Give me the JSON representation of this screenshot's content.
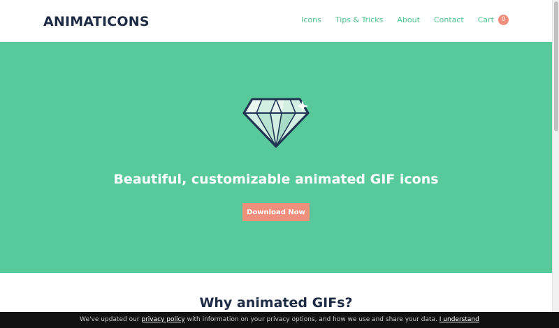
{
  "header": {
    "logo": "ANIMATICONS",
    "nav": [
      "Icons",
      "Tips & Tricks",
      "About",
      "Contact"
    ],
    "cart_label": "Cart",
    "cart_count": "0"
  },
  "hero": {
    "title": "Beautiful, customizable animated GIF icons",
    "cta_label": "Download Now",
    "icon": "diamond-icon"
  },
  "section": {
    "title": "Why animated GIFs?"
  },
  "cookie": {
    "text_before": "We've updated our",
    "policy_link": "privacy policy",
    "text_after": "with information on your privacy options, and how we use and share your data.",
    "accept_link": "I understand"
  },
  "colors": {
    "brand_green": "#57c99a",
    "accent_coral": "#ef8f7c",
    "navy": "#1e2b45",
    "nav_link": "#4fc08f"
  }
}
